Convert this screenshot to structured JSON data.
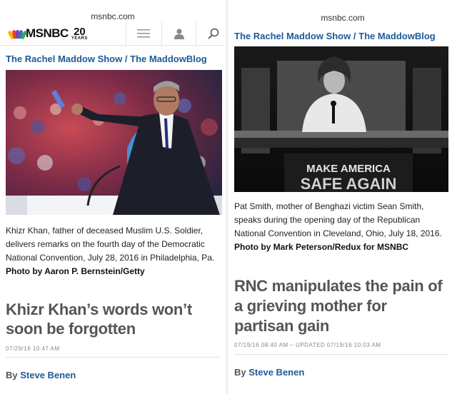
{
  "left": {
    "url": "msnbc.com",
    "logo": {
      "brand": "MSNBC",
      "badge_number": "20",
      "badge_word": "YEARS"
    },
    "toolbar": {
      "menu_icon": "hamburger-icon",
      "account_icon": "user-icon",
      "search_icon": "search-icon"
    },
    "section": {
      "show": "The Rachel Maddow Show",
      "separator": "/",
      "blog": "The MaddowBlog"
    },
    "caption": {
      "text": "Khizr Khan, father of deceased Muslim U.S. Soldier, delivers remarks on the fourth day of the Democratic National Convention, July 28, 2016 in Philadelphia, Pa.",
      "credit": "Photo by Aaron P. Bernstein/Getty"
    },
    "headline": "Khizr Khan’s words won’t soon be forgotten",
    "dateline": "07/29/16 10:47 AM",
    "byline": {
      "prefix": "By",
      "author": "Steve Benen"
    }
  },
  "right": {
    "url": "msnbc.com",
    "section": {
      "show": "The Rachel Maddow Show",
      "separator": "/",
      "blog": "The MaddowBlog"
    },
    "photo_sign": {
      "line1": "MAKE AMERICA",
      "line2": "SAFE AGAIN"
    },
    "caption": {
      "text": "Pat Smith, mother of Benghazi victim Sean Smith, speaks during the opening day of the Republican National Convention in Cleveland, Ohio, July 18, 2016.",
      "credit": "Photo by Mark Peterson/Redux for MSNBC"
    },
    "headline": "RNC manipulates the pain of a grieving mother for partisan gain",
    "dateline": "07/19/16 08:40 AM – UPDATED 07/19/16 10:03 AM",
    "byline": {
      "prefix": "By",
      "author": "Steve Benen"
    }
  },
  "colors": {
    "link_blue": "#1e5a9a",
    "headline_gray": "#555555",
    "meta_gray": "#888888"
  }
}
